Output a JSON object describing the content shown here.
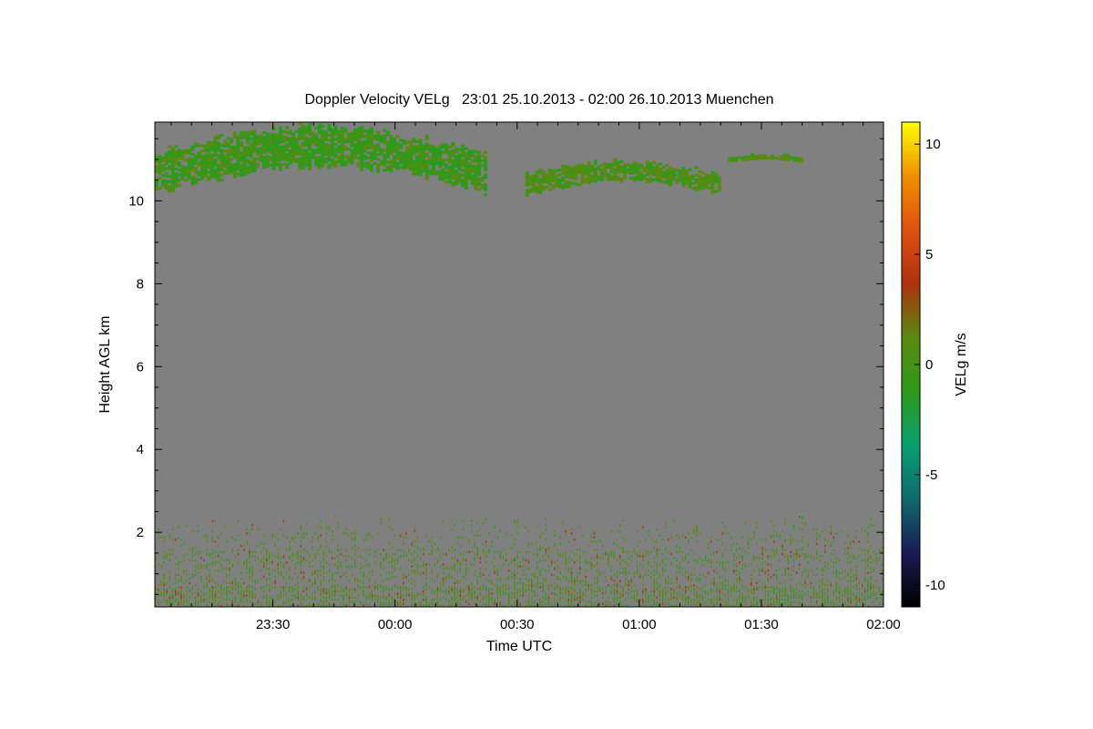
{
  "chart_data": {
    "type": "heatmap",
    "title": "Doppler Velocity VELg   23:01 25.10.2013 - 02:00 26.10.2013 Muenchen",
    "xlabel": "Time UTC",
    "ylabel": "Height AGL km",
    "colorbar_label": "VELg m/s",
    "x_range_minutes_since_2300": [
      1,
      180
    ],
    "x_ticks": [
      {
        "label": "23:30",
        "minute": 30
      },
      {
        "label": "00:00",
        "minute": 60
      },
      {
        "label": "00:30",
        "minute": 90
      },
      {
        "label": "01:00",
        "minute": 120
      },
      {
        "label": "01:30",
        "minute": 150
      },
      {
        "label": "02:00",
        "minute": 180
      }
    ],
    "ylim": [
      0.2,
      11.9
    ],
    "y_ticks": [
      {
        "label": "2",
        "value": 2
      },
      {
        "label": "4",
        "value": 4
      },
      {
        "label": "6",
        "value": 6
      },
      {
        "label": "8",
        "value": 8
      },
      {
        "label": "10",
        "value": 10
      }
    ],
    "colorbar_range": [
      -11,
      11
    ],
    "colorbar_ticks": [
      {
        "label": "10",
        "value": 10
      },
      {
        "label": "5",
        "value": 5
      },
      {
        "label": "0",
        "value": 0
      },
      {
        "label": "-5",
        "value": -5
      },
      {
        "label": "-10",
        "value": -10
      }
    ],
    "background_color": "#808080",
    "colormap": [
      "#000000",
      "#1a1a55",
      "#0f6a6f",
      "#08a070",
      "#2c9a1a",
      "#5a8a10",
      "#b03010",
      "#e05010",
      "#f09000",
      "#ffff00"
    ],
    "cloud_layers": [
      {
        "time_minutes": [
          1,
          82
        ],
        "height_km": [
          10.1,
          11.7
        ],
        "mean_velocity": -0.5
      },
      {
        "time_minutes": [
          92,
          140
        ],
        "height_km": [
          10.1,
          10.9
        ],
        "mean_velocity": 0.5
      },
      {
        "time_minutes": [
          141,
          160
        ],
        "height_km": [
          10.9,
          11.1
        ],
        "mean_velocity": 0.5
      }
    ],
    "boundary_layer": {
      "time_minutes": [
        1,
        180
      ],
      "height_km": [
        0.2,
        2.4
      ],
      "mean_velocity": 0.8
    }
  }
}
